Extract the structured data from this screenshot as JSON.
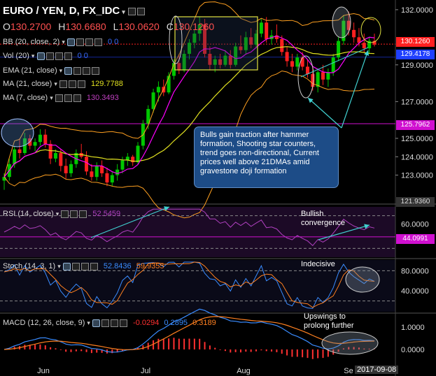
{
  "chart_data": {
    "type": "candlestick",
    "title": "EURO / YEN, D, FX_IDC",
    "ohlc": {
      "open": "130.2700",
      "high": "130.6680",
      "low": "130.0620",
      "close": "130.1260"
    },
    "price_axis": {
      "range": [
        121.5,
        132.3
      ],
      "ticks": [
        "132.0000",
        "129.0000",
        "127.0000",
        "125.0000",
        "124.0000",
        "123.0000"
      ]
    },
    "price_labels": {
      "current": "130.1260",
      "bb": "129.4178",
      "ma7_line": "125.7962",
      "bottom": "121.9360"
    },
    "x_ticks": [
      "Jun",
      "Jul",
      "Aug",
      "Se"
    ],
    "date_label": "2017-09-08",
    "candles": [
      [
        122.7,
        123.1,
        122.2,
        122.9
      ],
      [
        122.9,
        123.9,
        122.7,
        123.6
      ],
      [
        123.6,
        124.6,
        123.4,
        124.4
      ],
      [
        124.4,
        125.0,
        123.9,
        124.2
      ],
      [
        124.2,
        125.3,
        124.1,
        125.0
      ],
      [
        125.0,
        125.2,
        124.4,
        124.6
      ],
      [
        124.6,
        125.0,
        124.3,
        124.8
      ],
      [
        124.8,
        125.5,
        124.6,
        125.2
      ],
      [
        125.2,
        125.5,
        124.5,
        124.7
      ],
      [
        124.7,
        124.9,
        123.6,
        123.9
      ],
      [
        123.9,
        124.4,
        123.7,
        124.2
      ],
      [
        124.2,
        124.4,
        123.2,
        123.5
      ],
      [
        123.5,
        123.9,
        122.8,
        123.1
      ],
      [
        123.1,
        123.8,
        122.9,
        123.6
      ],
      [
        123.6,
        124.4,
        123.4,
        124.2
      ],
      [
        124.2,
        124.7,
        123.9,
        124.0
      ],
      [
        124.0,
        124.3,
        123.0,
        123.2
      ],
      [
        123.2,
        123.6,
        122.7,
        122.9
      ],
      [
        122.9,
        123.7,
        122.7,
        123.5
      ],
      [
        123.5,
        123.8,
        122.9,
        123.1
      ],
      [
        123.1,
        123.4,
        122.4,
        122.6
      ],
      [
        122.6,
        123.2,
        122.4,
        123.0
      ],
      [
        123.0,
        123.6,
        122.7,
        123.3
      ],
      [
        123.3,
        124.0,
        123.1,
        123.8
      ],
      [
        123.8,
        124.2,
        123.5,
        124.0
      ],
      [
        124.0,
        124.1,
        123.5,
        123.7
      ],
      [
        123.7,
        124.8,
        123.6,
        124.6
      ],
      [
        124.6,
        126.0,
        124.4,
        125.8
      ],
      [
        125.8,
        126.8,
        125.5,
        126.6
      ],
      [
        126.6,
        127.7,
        126.4,
        127.5
      ],
      [
        127.5,
        128.1,
        127.0,
        127.8
      ],
      [
        127.8,
        128.2,
        127.3,
        127.5
      ],
      [
        127.5,
        128.6,
        127.4,
        128.4
      ],
      [
        128.4,
        129.3,
        128.2,
        129.1
      ],
      [
        129.1,
        129.6,
        128.5,
        128.7
      ],
      [
        128.7,
        129.8,
        128.6,
        129.6
      ],
      [
        129.6,
        130.4,
        129.3,
        130.2
      ],
      [
        130.2,
        130.9,
        129.9,
        130.7
      ],
      [
        130.7,
        131.6,
        130.3,
        131.2
      ],
      [
        131.2,
        131.5,
        129.4,
        129.6
      ],
      [
        129.6,
        130.0,
        128.7,
        129.0
      ],
      [
        129.0,
        129.5,
        128.6,
        129.3
      ],
      [
        129.3,
        129.6,
        128.8,
        129.0
      ],
      [
        129.0,
        129.8,
        128.9,
        129.5
      ],
      [
        129.5,
        129.8,
        128.8,
        129.0
      ],
      [
        129.0,
        130.2,
        128.9,
        130.0
      ],
      [
        130.0,
        130.6,
        129.6,
        129.8
      ],
      [
        129.8,
        130.8,
        129.6,
        130.5
      ],
      [
        130.5,
        131.0,
        129.9,
        130.1
      ],
      [
        130.1,
        130.9,
        129.9,
        130.7
      ],
      [
        130.7,
        131.5,
        130.5,
        131.3
      ],
      [
        131.3,
        131.6,
        130.2,
        130.4
      ],
      [
        130.4,
        130.9,
        130.1,
        130.6
      ],
      [
        130.6,
        131.2,
        130.2,
        130.4
      ],
      [
        130.4,
        130.6,
        129.5,
        129.7
      ],
      [
        129.7,
        130.0,
        128.9,
        129.2
      ],
      [
        129.2,
        129.6,
        128.6,
        128.9
      ],
      [
        128.9,
        129.6,
        128.7,
        129.4
      ],
      [
        129.4,
        129.7,
        128.7,
        128.9
      ],
      [
        128.9,
        129.3,
        128.3,
        128.5
      ],
      [
        128.5,
        128.9,
        127.6,
        127.8
      ],
      [
        127.8,
        128.8,
        127.5,
        128.6
      ],
      [
        128.6,
        129.0,
        127.9,
        128.2
      ],
      [
        128.2,
        128.8,
        127.8,
        128.6
      ],
      [
        128.6,
        129.6,
        128.4,
        129.4
      ],
      [
        129.4,
        130.5,
        129.2,
        130.3
      ],
      [
        130.3,
        131.7,
        130.1,
        131.4
      ],
      [
        131.4,
        131.9,
        130.6,
        130.9
      ],
      [
        130.9,
        131.3,
        130.2,
        130.5
      ],
      [
        130.5,
        131.0,
        130.0,
        130.2
      ],
      [
        130.2,
        130.7,
        129.7,
        129.9
      ],
      [
        129.9,
        130.5,
        129.6,
        130.3
      ],
      [
        130.3,
        130.7,
        130.0,
        130.1
      ]
    ],
    "panes": {
      "rsi": {
        "label": "RSI (14, close)",
        "value": "52.5459",
        "price_label": "44.0991",
        "ticks": [
          "60.0000"
        ]
      },
      "stoch": {
        "label": "Stoch (14, 3, 1)",
        "k": "52.8436",
        "d": "59.9355",
        "ticks": [
          "80.0000",
          "40.0000"
        ]
      },
      "macd": {
        "label": "MACD (12, 26, close, 9)",
        "hist": "-0.0294",
        "macd": "0.2895",
        "signal": "0.3189",
        "ticks": [
          "1.0000",
          "0.0000"
        ]
      }
    }
  },
  "indicators": {
    "bb": {
      "label": "BB (20, close, 2)",
      "values": "0   0"
    },
    "vol": {
      "label": "Vol (20)",
      "values": "0   0"
    },
    "ema": {
      "label": "EMA (21, close)"
    },
    "ma21": {
      "label": "MA (21, close)",
      "value": "129.7788"
    },
    "ma7": {
      "label": "MA (7, close)",
      "value": "130.3493"
    }
  },
  "annotations": {
    "callout": "Bulls gain traction after hammer formation, Shooting star counters, trend goes non-directional, Current prices well above 21DMAs amid gravestone doji formation",
    "rsi_note": "Bullish convergence",
    "stoch_note": "Indecisive",
    "macd_note": "Upswings to prolong further"
  },
  "colors": {
    "up": "#00c800",
    "down": "#ff2020",
    "bb": "#ffa020",
    "ema": "#e040e0",
    "ma21": "#e0e020",
    "ma7": "#ff00ff",
    "label_blue": "#1f3fff"
  }
}
